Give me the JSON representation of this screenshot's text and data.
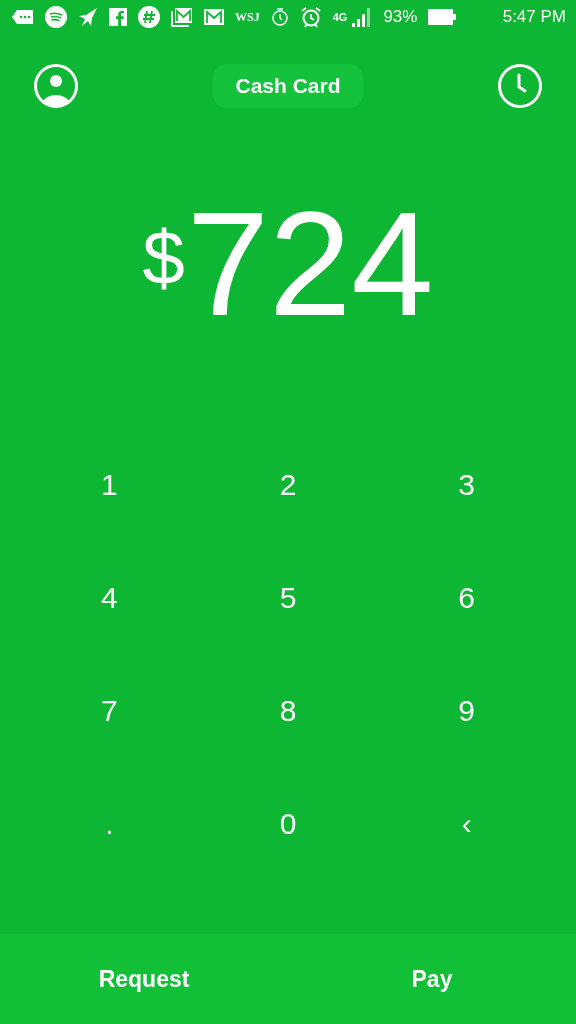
{
  "status_bar": {
    "wsj": "WSJ",
    "network": "4G",
    "battery": "93%",
    "time": "5:47 PM"
  },
  "header": {
    "tab": "Cash Card"
  },
  "amount": {
    "currency": "$",
    "value": "724"
  },
  "keypad": [
    "1",
    "2",
    "3",
    "4",
    "5",
    "6",
    "7",
    "8",
    "9",
    ".",
    "0",
    "‹"
  ],
  "actions": [
    "Request",
    "Pay"
  ]
}
